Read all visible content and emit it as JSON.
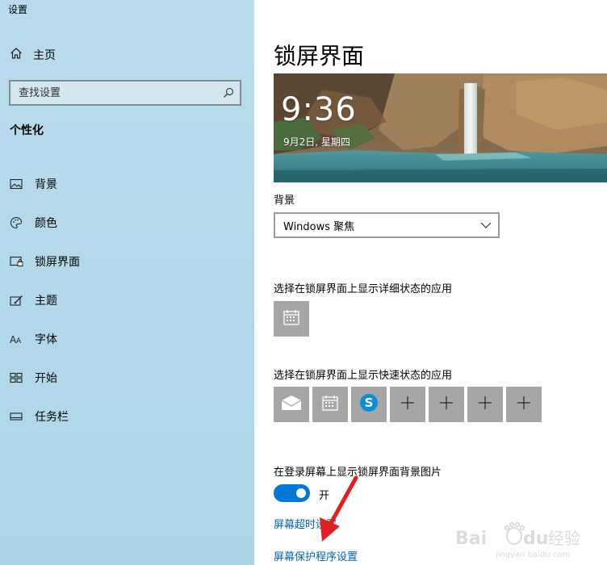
{
  "window": {
    "title": "设置"
  },
  "sidebar": {
    "home_label": "主页",
    "search_placeholder": "查找设置",
    "section_heading": "个性化",
    "items": [
      {
        "label": "背景",
        "icon": "image-icon"
      },
      {
        "label": "颜色",
        "icon": "palette-icon"
      },
      {
        "label": "锁屏界面",
        "icon": "lockscreen-icon"
      },
      {
        "label": "主题",
        "icon": "theme-icon"
      },
      {
        "label": "字体",
        "icon": "font-icon"
      },
      {
        "label": "开始",
        "icon": "start-icon"
      },
      {
        "label": "任务栏",
        "icon": "taskbar-icon"
      }
    ]
  },
  "main": {
    "title": "锁屏界面",
    "preview": {
      "time": "9:36",
      "date": "9月2日, 星期四"
    },
    "background_label": "背景",
    "background_value": "Windows 聚焦",
    "detailed_status_label": "选择在锁屏界面上显示详细状态的应用",
    "detailed_status_apps": [
      "calendar-icon"
    ],
    "quick_status_label": "选择在锁屏界面上显示快速状态的应用",
    "quick_status_apps": [
      "mail-icon",
      "calendar-icon",
      "skype-icon",
      "add-icon",
      "add-icon",
      "add-icon",
      "add-icon"
    ],
    "signin_bg_label": "在登录屏幕上显示锁屏界面背景图片",
    "signin_bg_toggle": {
      "on": true,
      "state_label": "开"
    },
    "screen_timeout_link": "屏幕超时设置",
    "screensaver_link": "屏幕保护程序设置"
  },
  "colors": {
    "sidebar_bg": "#b2d9ea",
    "accent": "#0078d7",
    "link": "#0063b1",
    "annotation_arrow": "#e02020"
  },
  "watermark": {
    "brand": "Baidu经验",
    "url": "jingyan.baidu.com"
  }
}
